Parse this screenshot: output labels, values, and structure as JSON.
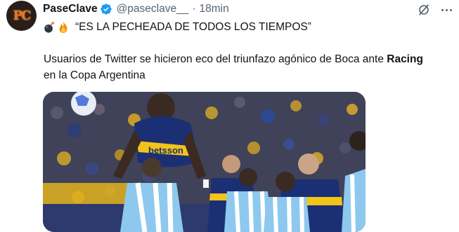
{
  "tweet": {
    "avatar_text": "PC",
    "display_name": "PaseClave",
    "handle": "@paseclave__",
    "separator": "·",
    "time": "18min",
    "headline": "“ES LA PECHEADA DE TODOS LOS TIEMPOS”",
    "paragraph_part1": "Usuarios de Twitter se hicieron eco del triunfazo agónico de Boca ante ",
    "paragraph_bold": "Racing",
    "paragraph_part2": " en la Copa Argentina",
    "sponsor_text": "betsson"
  },
  "colors": {
    "verified": "#1d9bf0",
    "secondary_text": "#536471",
    "boca_blue": "#1b2f74",
    "boca_yellow": "#f2c318",
    "racing_sky": "#8ec8ee"
  }
}
